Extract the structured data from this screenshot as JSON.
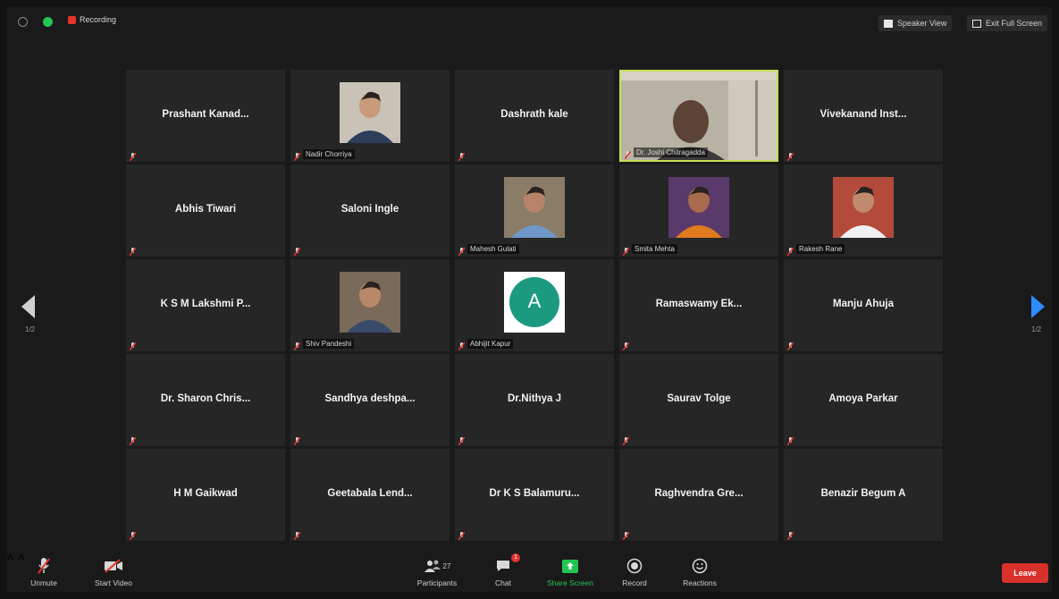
{
  "topbar": {
    "recording_label": "Recording",
    "speaker_view_label": "Speaker View",
    "exit_fullscreen_label": "Exit Full Screen"
  },
  "participants": [
    {
      "name": "Prashant Kanad...",
      "kind": "name"
    },
    {
      "name": "Nadir Chorriya",
      "kind": "photo",
      "photo": "man-suit"
    },
    {
      "name": "Dashrath kale",
      "kind": "name"
    },
    {
      "name": "Dr. Joshi Chitragadda",
      "kind": "video"
    },
    {
      "name": "Vivekanand Inst...",
      "kind": "name"
    },
    {
      "name": "Abhis Tiwari",
      "kind": "name"
    },
    {
      "name": "Saloni Ingle",
      "kind": "name"
    },
    {
      "name": "Mahesh Gulati",
      "kind": "photo",
      "photo": "man-glasses"
    },
    {
      "name": "Smita Mehta",
      "kind": "photo",
      "photo": "woman-orange"
    },
    {
      "name": "Rakesh Rane",
      "kind": "photo",
      "photo": "man-red"
    },
    {
      "name": "K S M Lakshmi P...",
      "kind": "name"
    },
    {
      "name": "Shiv Pandeshi",
      "kind": "photo",
      "photo": "man-tie"
    },
    {
      "name": "Abhijit Kapur",
      "kind": "avatar",
      "initial": "A"
    },
    {
      "name": "Ramaswamy Ek...",
      "kind": "name"
    },
    {
      "name": "Manju Ahuja",
      "kind": "name"
    },
    {
      "name": "Dr. Sharon Chris...",
      "kind": "name"
    },
    {
      "name": "Sandhya deshpa...",
      "kind": "name"
    },
    {
      "name": "Dr.Nithya J",
      "kind": "name"
    },
    {
      "name": "Saurav Tolge",
      "kind": "name"
    },
    {
      "name": "Amoya Parkar",
      "kind": "name"
    },
    {
      "name": "H M Gaikwad",
      "kind": "name"
    },
    {
      "name": "Geetabala Lend...",
      "kind": "name"
    },
    {
      "name": "Dr K S Balamuru...",
      "kind": "name"
    },
    {
      "name": "Raghvendra Gre...",
      "kind": "name"
    },
    {
      "name": "Benazir Begum A",
      "kind": "name"
    }
  ],
  "pagination": {
    "prev": "1/2",
    "next": "1/2"
  },
  "toolbar": {
    "unmute": "Unmute",
    "start_video": "Start Video",
    "participants": "Participants",
    "participants_count": "27",
    "chat": "Chat",
    "chat_badge": "1",
    "share_screen": "Share Screen",
    "record": "Record",
    "reactions": "Reactions",
    "end": "Leave"
  },
  "colors": {
    "active_speaker": "#c5e05a",
    "mute_red": "#e5342c",
    "share_green": "#23c552",
    "next_arrow": "#2d8cff",
    "avatar_teal": "#1b9a80"
  }
}
